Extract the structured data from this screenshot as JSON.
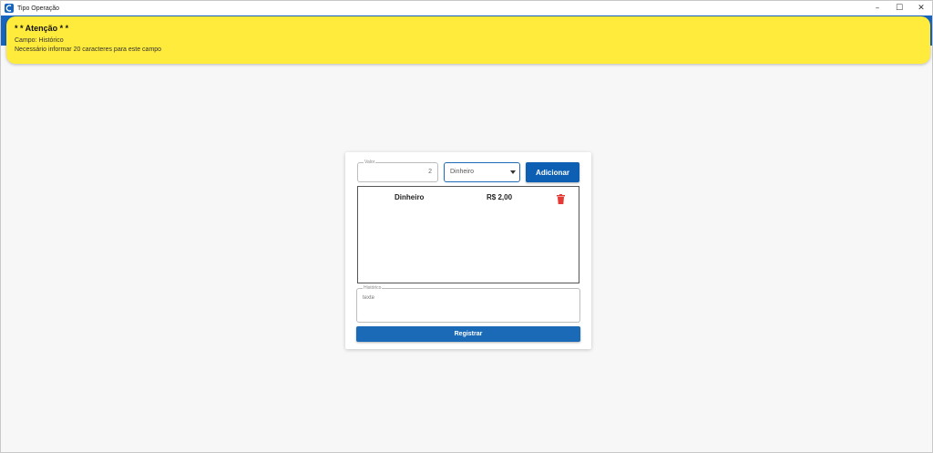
{
  "window": {
    "title": "Tipo Operação",
    "controls": {
      "minimize": "–",
      "maximize": "☐",
      "close": "✕"
    }
  },
  "alert": {
    "title": "* * Atenção * *",
    "field_line": "Campo: Histórico",
    "message_line": "Necessário informar 20 caracteres para este campo",
    "background": "#ffeb3b"
  },
  "form": {
    "valor": {
      "label": "Valor",
      "value": "2"
    },
    "payment_select": {
      "value": "Dinheiro"
    },
    "add_label": "Adicionar",
    "items": [
      {
        "name": "Dinheiro",
        "amount": "R$ 2,00",
        "icon": "trash-icon"
      }
    ],
    "historico": {
      "label": "Histórico",
      "value": "texte"
    },
    "register_label": "Registrar"
  },
  "colors": {
    "primary": "#1565c0",
    "button": "#0d5fb3",
    "delete": "#e53935"
  }
}
